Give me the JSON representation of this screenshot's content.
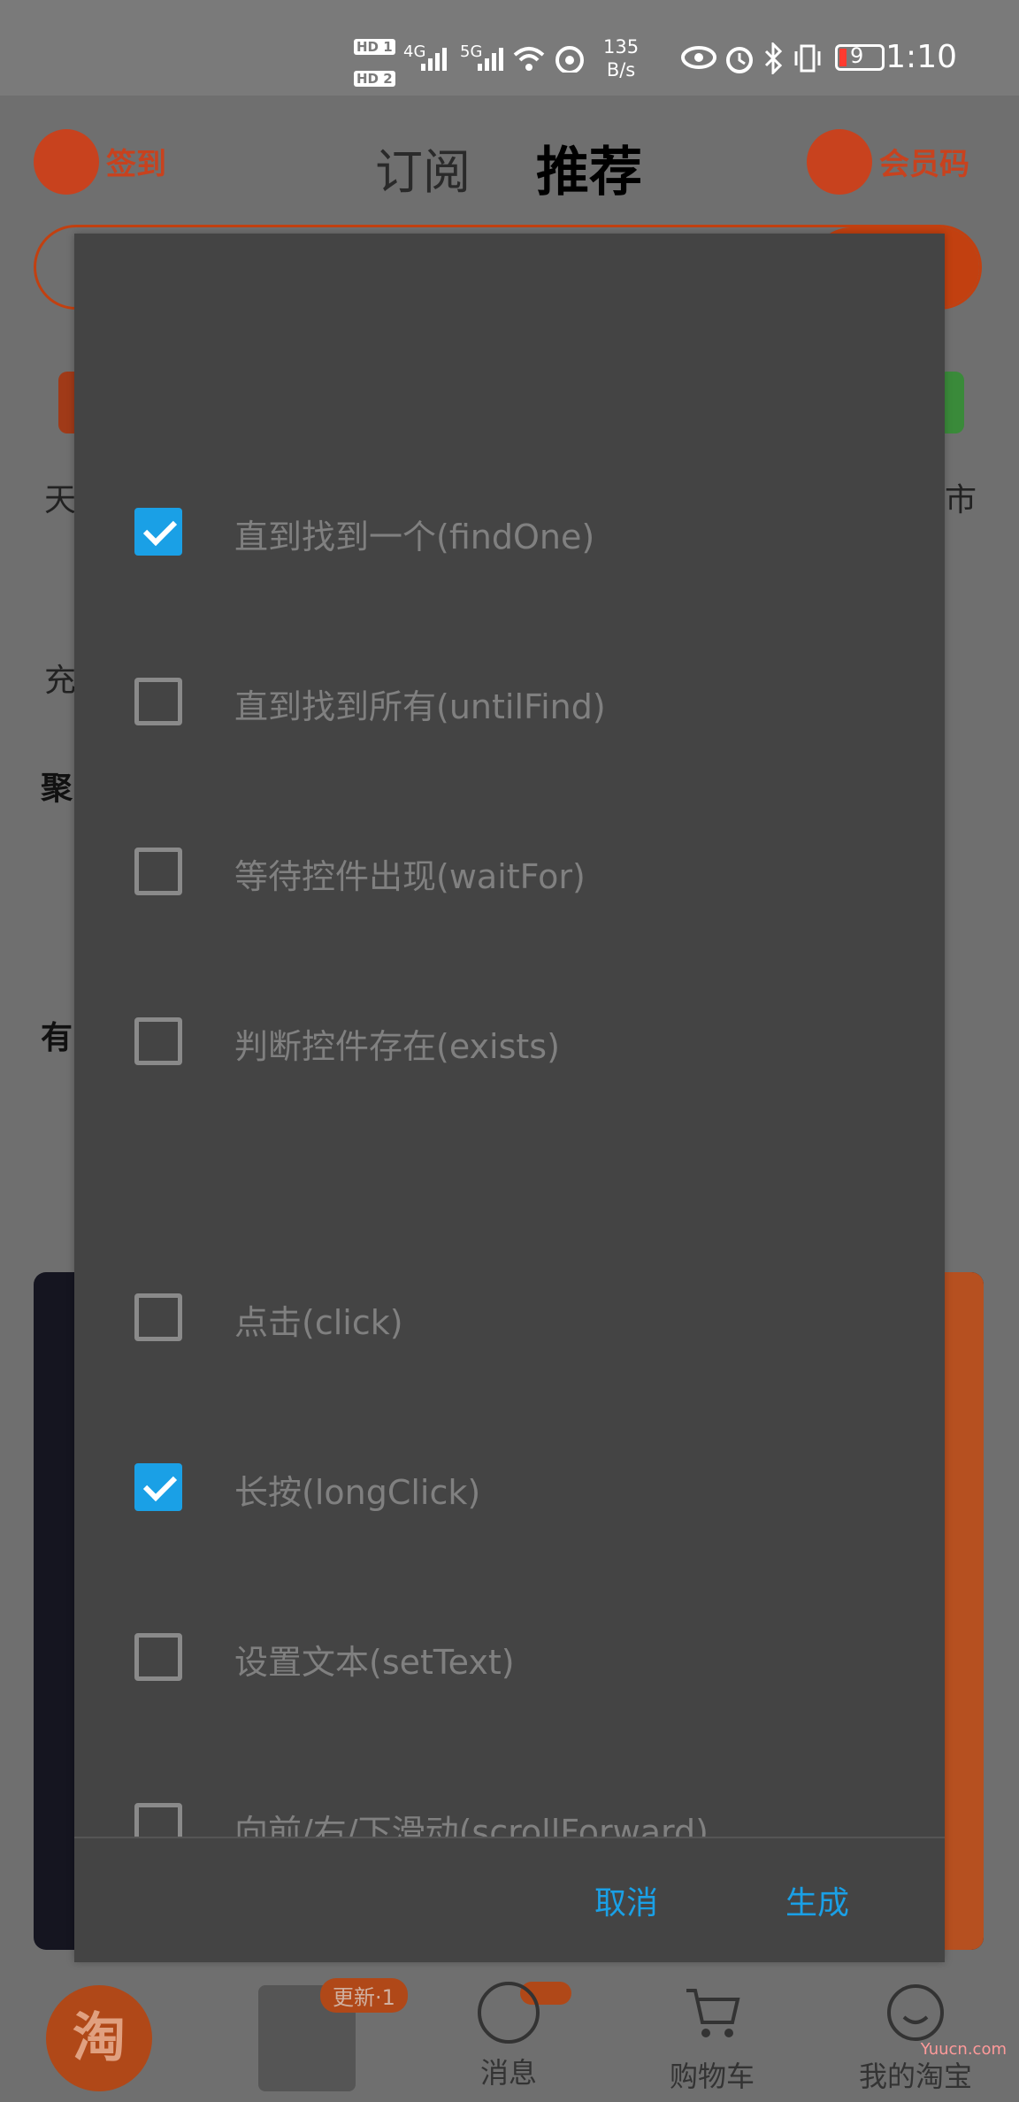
{
  "status_bar": {
    "hd1": "HD 1",
    "hd2": "HD 2",
    "net1": "4G",
    "net2": "5G",
    "speed_value": "135",
    "speed_unit": "B/s",
    "battery": "9",
    "time": "1:10"
  },
  "background": {
    "top_left_label": "签到",
    "tab_subscribe": "订阅",
    "tab_recommend": "推荐",
    "top_right_label": "会员码",
    "side_texts": [
      "天",
      "充",
      "聚",
      "有",
      "市"
    ],
    "nav": {
      "home": "淘",
      "update_badge": "更新·1",
      "messages": "消息",
      "cart": "购物车",
      "mine": "我的淘宝"
    },
    "watermark": "Yuucn.com"
  },
  "dialog": {
    "options": [
      {
        "label": "直到找到一个(findOne)",
        "checked": true
      },
      {
        "label": "直到找到所有(untilFind)",
        "checked": false
      },
      {
        "label": "等待控件出现(waitFor)",
        "checked": false
      },
      {
        "label": "判断控件存在(exists)",
        "checked": false
      },
      {
        "label": "点击(click)",
        "checked": false
      },
      {
        "label": "长按(longClick)",
        "checked": true
      },
      {
        "label": "设置文本(setText)",
        "checked": false
      },
      {
        "label": "向前/右/下滑动(scrollForward)",
        "checked": false
      }
    ],
    "cancel_label": "取消",
    "confirm_label": "生成"
  },
  "colors": {
    "accent": "#1aa0e6",
    "dialog_bg": "#444444",
    "brand_orange": "#c24010"
  }
}
